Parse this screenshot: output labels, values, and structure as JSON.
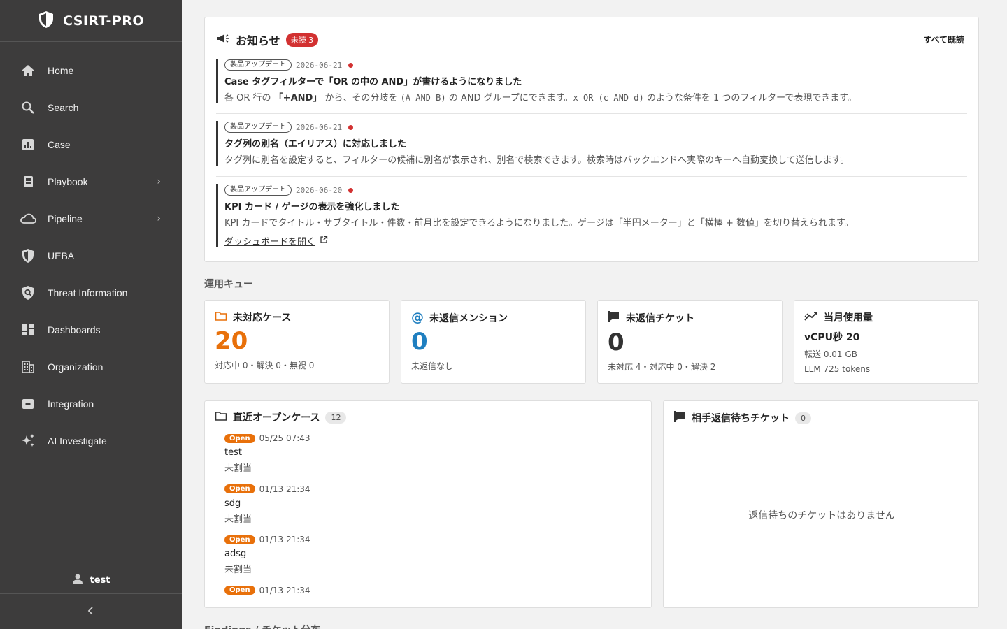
{
  "app": {
    "name": "CSIRT-PRO"
  },
  "sidebar": {
    "items": [
      {
        "label": "Home",
        "icon": "home-icon"
      },
      {
        "label": "Search",
        "icon": "search-icon"
      },
      {
        "label": "Case",
        "icon": "chart-icon"
      },
      {
        "label": "Playbook",
        "icon": "book-icon",
        "has_submenu": true
      },
      {
        "label": "Pipeline",
        "icon": "cloud-icon",
        "has_submenu": true
      },
      {
        "label": "UEBA",
        "icon": "shield-icon"
      },
      {
        "label": "Threat Information",
        "icon": "shield-search-icon"
      },
      {
        "label": "Dashboards",
        "icon": "dashboard-icon"
      },
      {
        "label": "Organization",
        "icon": "building-icon"
      },
      {
        "label": "Integration",
        "icon": "integration-icon"
      },
      {
        "label": "AI Investigate",
        "icon": "sparkle-icon"
      }
    ],
    "user": "test"
  },
  "notices": {
    "title": "お知らせ",
    "unread_badge": "未読 3",
    "mark_all_read": "すべて既読",
    "items": [
      {
        "tag": "製品アップデート",
        "date": "2026-06-21",
        "title": "Case タグフィルターで「OR の中の AND」が書けるようになりました",
        "body_1": "各 OR 行の ",
        "body_bold": "「+AND」",
        "body_2": " から、その分岐を ",
        "code_1": "(A AND B)",
        "body_3": " の AND グループにできます。",
        "code_2": "x OR (c AND d)",
        "body_4": " のような条件を 1 つのフィルターで表現できます。"
      },
      {
        "tag": "製品アップデート",
        "date": "2026-06-21",
        "title": "タグ列の別名（エイリアス）に対応しました",
        "body": "タグ列に別名を設定すると、フィルターの候補に別名が表示され、別名で検索できます。検索時はバックエンドへ実際のキーへ自動変換して送信します。"
      },
      {
        "tag": "製品アップデート",
        "date": "2026-06-20",
        "title": "KPI カード / ゲージの表示を強化しました",
        "body": "KPI カードでタイトル・サブタイトル・件数・前月比を設定できるようになりました。ゲージは「半円メーター」と「横棒 + 数値」を切り替えられます。",
        "link": "ダッシュボードを開く"
      }
    ]
  },
  "queue": {
    "title": "運用キュー",
    "cards": [
      {
        "title": "未対応ケース",
        "value": "20",
        "sub": "対応中 0・解決 0・無視 0",
        "color": "#e8700a"
      },
      {
        "title": "未返信メンション",
        "value": "0",
        "sub": "未返信なし",
        "color": "#1f7fc0"
      },
      {
        "title": "未返信チケット",
        "value": "0",
        "sub": "未対応 4・対応中 0・解決 2",
        "color": "#333333"
      },
      {
        "title": "当月使用量",
        "usage": "vCPU秒 20",
        "transfer": "転送 0.01 GB",
        "llm": "LLM 725 tokens"
      }
    ]
  },
  "open_cases": {
    "title": "直近オープンケース",
    "count": "12",
    "items": [
      {
        "status": "Open",
        "time": "05/25 07:43",
        "name": "test",
        "assignee": "未割当"
      },
      {
        "status": "Open",
        "time": "01/13 21:34",
        "name": "sdg",
        "assignee": "未割当"
      },
      {
        "status": "Open",
        "time": "01/13 21:34",
        "name": "adsg",
        "assignee": "未割当"
      },
      {
        "status": "Open",
        "time": "01/13 21:34",
        "name": "",
        "assignee": ""
      }
    ]
  },
  "waiting_tickets": {
    "title": "相手返信待ちチケット",
    "count": "0",
    "empty": "返信待ちのチケットはありません"
  },
  "next_section": {
    "title": "Findings / チケット分布"
  }
}
